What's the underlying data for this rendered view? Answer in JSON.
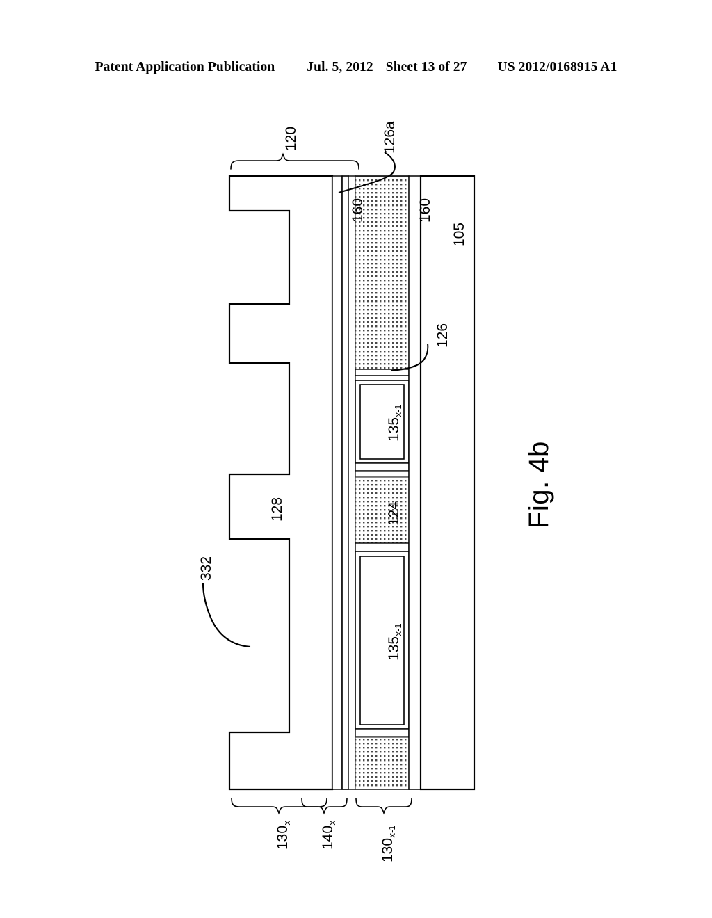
{
  "header": {
    "title": "Patent Application Publication",
    "date": "Jul. 5, 2012",
    "sheet": "Sheet 13 of 27",
    "doc_id": "US 2012/0168915 A1"
  },
  "figure": {
    "caption": "Fig. 4b",
    "labels": {
      "brace_120": "120",
      "lead_126a": "126a",
      "line_160_left": "160",
      "line_160_right": "160",
      "substrate_105": "105",
      "lead_126": "126",
      "stack_135_upper": "135",
      "stack_135_upper_sub": "x-1",
      "layer_124": "124",
      "stack_135_lower": "135",
      "stack_135_lower_sub": "x-1",
      "body_128": "128",
      "lead_332": "332",
      "brace_130x": "130",
      "brace_130x_sub": "x",
      "brace_140x": "140",
      "brace_140x_sub": "x",
      "brace_130x_1": "130",
      "brace_130x_1_sub": "x-1"
    },
    "colors": {
      "stroke": "#000000",
      "hatch_dot": "#4a4a4a",
      "background": "#ffffff"
    }
  }
}
